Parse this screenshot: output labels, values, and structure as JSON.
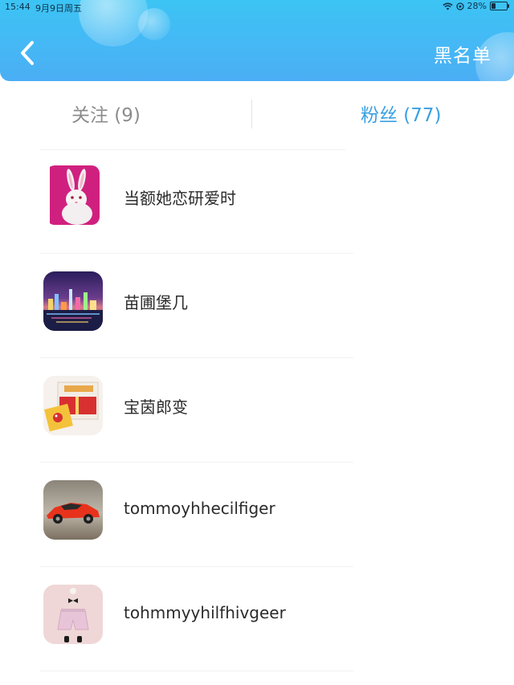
{
  "status_bar": {
    "time": "15:44",
    "date": "9月9日周五",
    "battery": "28%",
    "battery_level": 0.28
  },
  "header": {
    "back_icon": "chevron-left-icon",
    "action_label": "黑名单",
    "color": "#45b8f5"
  },
  "tabs": [
    {
      "label": "关注 (9)",
      "active": false
    },
    {
      "label": "粉丝 (77)",
      "active": true
    }
  ],
  "active_color": "#3aa0e2",
  "fans": [
    {
      "name": "当额她恋研爱时",
      "avatar": "rabbit-avatar"
    },
    {
      "name": "苗圃堡几",
      "avatar": "city-night-avatar"
    },
    {
      "name": "宝茵郎变",
      "avatar": "gift-box-avatar"
    },
    {
      "name": "tommoyhhecilfiger",
      "avatar": "red-sports-car-avatar"
    },
    {
      "name": "tohmmyyhilfhivgeer",
      "avatar": "pink-shorts-avatar"
    }
  ]
}
